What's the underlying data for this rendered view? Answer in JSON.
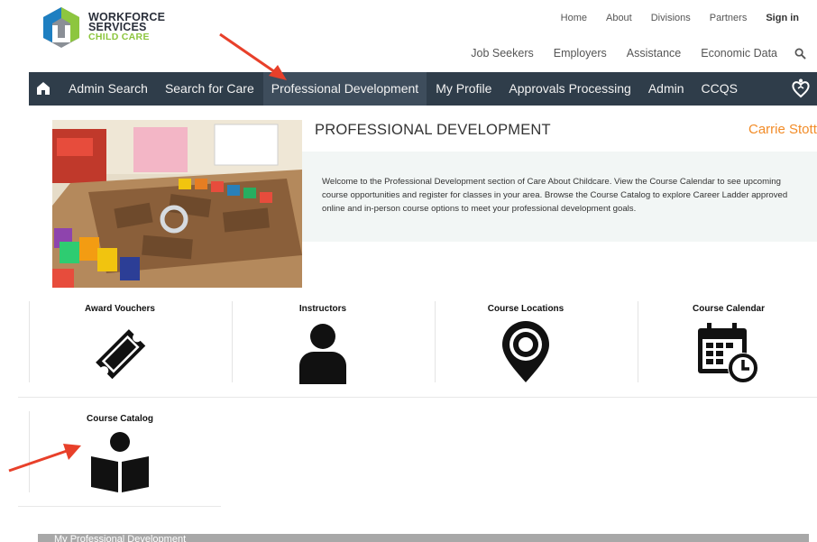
{
  "logo": {
    "line1": "WORKFORCE",
    "line2": "SERVICES",
    "line3": "CHILD CARE"
  },
  "top_links": [
    "Home",
    "About",
    "Divisions",
    "Partners",
    "Sign in"
  ],
  "secondary_links": [
    "Job Seekers",
    "Employers",
    "Assistance",
    "Economic Data"
  ],
  "nav": {
    "items": [
      "Admin Search",
      "Search for Care",
      "Professional Development",
      "My Profile",
      "Approvals Processing",
      "Admin",
      "CCQS"
    ],
    "active": "Professional Development"
  },
  "hero": {
    "title": "PROFESSIONAL DEVELOPMENT",
    "user": "Carrie Stott",
    "welcome": "Welcome to the Professional Development section of Care About Childcare. View the Course Calendar to see upcoming course opportunities and register for classes in your area. Browse the Course Catalog to explore Career Ladder approved online and in-person course options to meet your professional development goals."
  },
  "tiles": [
    {
      "label": "Award Vouchers",
      "icon": "ticket-icon"
    },
    {
      "label": "Instructors",
      "icon": "person-icon"
    },
    {
      "label": "Course Locations",
      "icon": "map-pin-icon"
    },
    {
      "label": "Course Calendar",
      "icon": "calendar-clock-icon"
    },
    {
      "label": "Course Catalog",
      "icon": "reader-book-icon"
    }
  ],
  "bottom_bar": {
    "label": "My Professional Development"
  },
  "colors": {
    "nav_bg": "#2f3d4a",
    "accent_orange": "#f28c28",
    "logo_green": "#8dc63f",
    "arrow_red": "#e8402a"
  }
}
